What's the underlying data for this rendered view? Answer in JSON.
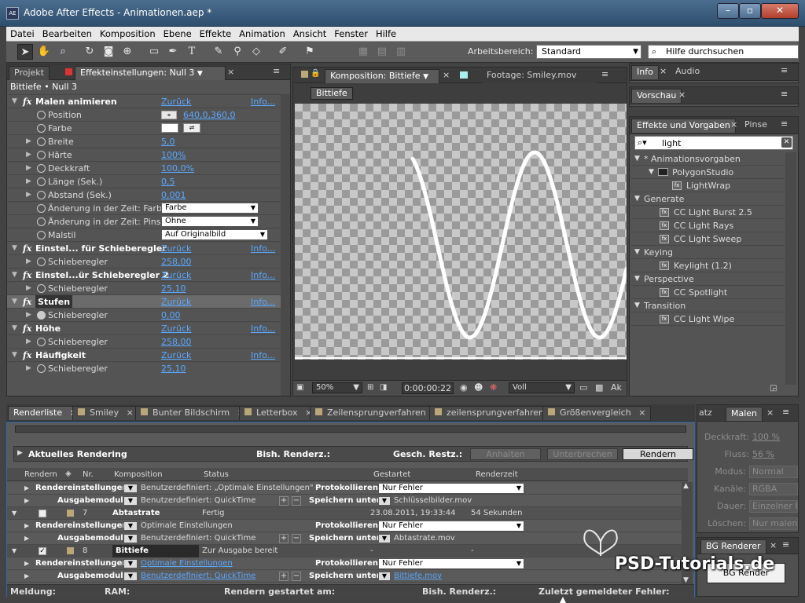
{
  "window": {
    "app_icon": "AE",
    "title": "Adobe After Effects - Animationen.aep *"
  },
  "menu": [
    "Datei",
    "Bearbeiten",
    "Komposition",
    "Ebene",
    "Effekte",
    "Animation",
    "Ansicht",
    "Fenster",
    "Hilfe"
  ],
  "toolbar": {
    "workspace_label": "Arbeitsbereich:",
    "workspace_value": "Standard",
    "help_placeholder": "Hilfe durchsuchen"
  },
  "left_panel": {
    "tabs": [
      "Projekt",
      "Effekteinstellungen: Null 3"
    ],
    "crumb": "Bittiefe • Null 3",
    "rows": [
      {
        "type": "fx",
        "label": "Malen animieren",
        "reset": "Zurück",
        "info": "Info..."
      },
      {
        "type": "prop",
        "label": "Position",
        "value": "640,0,360,0",
        "target": true
      },
      {
        "type": "prop",
        "label": "Farbe",
        "swatch": true
      },
      {
        "type": "prop",
        "label": "Breite",
        "value": "5,0",
        "tw": true
      },
      {
        "type": "prop",
        "label": "Härte",
        "value": "100%",
        "tw": true
      },
      {
        "type": "prop",
        "label": "Deckkraft",
        "value": "100,0%",
        "tw": true
      },
      {
        "type": "prop",
        "label": "Länge (Sek.)",
        "value": "0,5",
        "tw": true
      },
      {
        "type": "prop",
        "label": "Abstand (Sek.)",
        "value": "0,001",
        "tw": true
      },
      {
        "type": "prop",
        "label": "Änderung in der Zeit: Farbe",
        "dropdown": "Farbe"
      },
      {
        "type": "prop",
        "label": "Änderung in der Zeit: Pinsel",
        "dropdown": "Ohne"
      },
      {
        "type": "prop",
        "label": "Malstil",
        "dropdown": "Auf Originalbild"
      },
      {
        "type": "fx",
        "label": "Einstel... für Schieberegler",
        "reset": "Zurück",
        "info": "Info..."
      },
      {
        "type": "prop",
        "label": "Schieberegler",
        "value": "258,00",
        "tw": true
      },
      {
        "type": "fx",
        "label": "Einstel...ür Schieberegler 2",
        "reset": "Zurück",
        "info": "Info..."
      },
      {
        "type": "prop",
        "label": "Schieberegler",
        "value": "25,10",
        "tw": true
      },
      {
        "type": "fx",
        "label": "Stufen",
        "reset": "Zurück",
        "info": "Info...",
        "selected": true
      },
      {
        "type": "prop",
        "label": "Schieberegler",
        "value": "0,00",
        "tw": true,
        "active_sw": true
      },
      {
        "type": "fx",
        "label": "Höhe",
        "reset": "Zurück",
        "info": "Info..."
      },
      {
        "type": "prop",
        "label": "Schieberegler",
        "value": "258,00",
        "tw": true
      },
      {
        "type": "fx",
        "label": "Häufigkeit",
        "reset": "Zurück",
        "info": "Info..."
      },
      {
        "type": "prop",
        "label": "Schieberegler",
        "value": "25,10",
        "tw": true
      }
    ]
  },
  "comp_panel": {
    "tab_comp": "Komposition: Bittiefe",
    "tab_footage": "Footage: Smiley.mov",
    "chip": "Bittiefe",
    "zoom": "50%",
    "timecode": "0:00:00:22",
    "resolution": "Voll",
    "trunc": "Ak"
  },
  "right_panel": {
    "tabs_top": [
      "Info",
      "Audio"
    ],
    "tab_preview": "Vorschau",
    "tabs_fx": [
      "Effekte und Vorgaben",
      "Pinse"
    ],
    "search": "light",
    "tree": [
      {
        "label": "* Animationsvorgaben",
        "indent": 0,
        "kind": "group"
      },
      {
        "label": "PolygonStudio",
        "indent": 1,
        "kind": "folder"
      },
      {
        "label": "LightWrap",
        "indent": 2,
        "kind": "item"
      },
      {
        "label": "Generate",
        "indent": 0,
        "kind": "group"
      },
      {
        "label": "CC Light Burst 2.5",
        "indent": 1,
        "kind": "item"
      },
      {
        "label": "CC Light Rays",
        "indent": 1,
        "kind": "item"
      },
      {
        "label": "CC Light Sweep",
        "indent": 1,
        "kind": "item"
      },
      {
        "label": "Keying",
        "indent": 0,
        "kind": "group"
      },
      {
        "label": "Keylight (1.2)",
        "indent": 1,
        "kind": "item"
      },
      {
        "label": "Perspective",
        "indent": 0,
        "kind": "group"
      },
      {
        "label": "CC Spotlight",
        "indent": 1,
        "kind": "item"
      },
      {
        "label": "Transition",
        "indent": 0,
        "kind": "group"
      },
      {
        "label": "CC Light Wipe",
        "indent": 1,
        "kind": "item"
      }
    ]
  },
  "render_panel": {
    "tabs": [
      "Renderliste",
      "Smiley",
      "Bunter Bildschirm",
      "Letterbox",
      "Zeilensprungverfahren",
      "zeilensprungverfahren",
      "Größenvergleich"
    ],
    "current": "Aktuelles Rendering",
    "bish": "Bish. Renderz.:",
    "gesch": "Gesch. Restz.:",
    "btn_pause": "Anhalten",
    "btn_stop": "Unterbrechen",
    "btn_render": "Rendern",
    "cols": [
      "Rendern",
      "Nr.",
      "Komposition",
      "Status",
      "Gestartet",
      "Renderzeit"
    ],
    "items": [
      {
        "kind": "settings",
        "label": "Rendereinstellungen:",
        "value": "Benutzerdefiniert: „Optimale Einstellungen\"",
        "log_label": "Protokollieren:",
        "log": "Nur Fehler"
      },
      {
        "kind": "output",
        "label": "Ausgabemodul:",
        "value": "Benutzerdefiniert: QuickTime",
        "save_label": "Speichern unter:",
        "file": "Schlüsselbilder.mov"
      },
      {
        "kind": "item",
        "nr": "7",
        "comp": "Abtastrate",
        "status": "Fertig",
        "started": "23.08.2011, 19:33:44",
        "time": "54 Sekunden"
      },
      {
        "kind": "settings",
        "label": "Rendereinstellungen:",
        "value": "Optimale Einstellungen",
        "log_label": "Protokollieren:",
        "log": "Nur Fehler"
      },
      {
        "kind": "output",
        "label": "Ausgabemodul:",
        "value": "Benutzerdefiniert: QuickTime",
        "save_label": "Speichern unter:",
        "file": "Abtastrate.mov"
      },
      {
        "kind": "item",
        "nr": "8",
        "comp": "Bittiefe",
        "status": "Zur Ausgabe bereit",
        "started": "-",
        "time": "-"
      },
      {
        "kind": "settings",
        "label": "Rendereinstellungen:",
        "value": "Optimale Einstellungen",
        "log_label": "Protokollieren:",
        "log": "Nur Fehler",
        "link": true
      },
      {
        "kind": "output",
        "label": "Ausgabemodul:",
        "value": "Benutzerdefiniert: QuickTime",
        "save_label": "Speichern unter:",
        "file": "Bittiefe.mov",
        "link": true
      }
    ],
    "footer": {
      "msg": "Meldung:",
      "ram": "RAM:",
      "start": "Rendern gestartet am:",
      "bish": "Bish. Renderz.:",
      "err": "Zuletzt gemeldeter Fehler:"
    }
  },
  "paint_panel": {
    "tab_prev": "atz",
    "tab": "Malen",
    "rows": [
      {
        "label": "Deckkraft:",
        "value": "100 %"
      },
      {
        "label": "Fluss:",
        "value": "56 %"
      },
      {
        "label": "Modus:",
        "value": "Normal"
      },
      {
        "label": "Kanäle:",
        "value": "RGBA"
      },
      {
        "label": "Dauer:",
        "value": "Einzelner Fr"
      },
      {
        "label": "Löschen:",
        "value": "Nur malen"
      }
    ]
  },
  "bg_panel": {
    "tab": "BG Renderer",
    "button": "BG Render"
  },
  "watermark": "PSD-Tutorials.de"
}
